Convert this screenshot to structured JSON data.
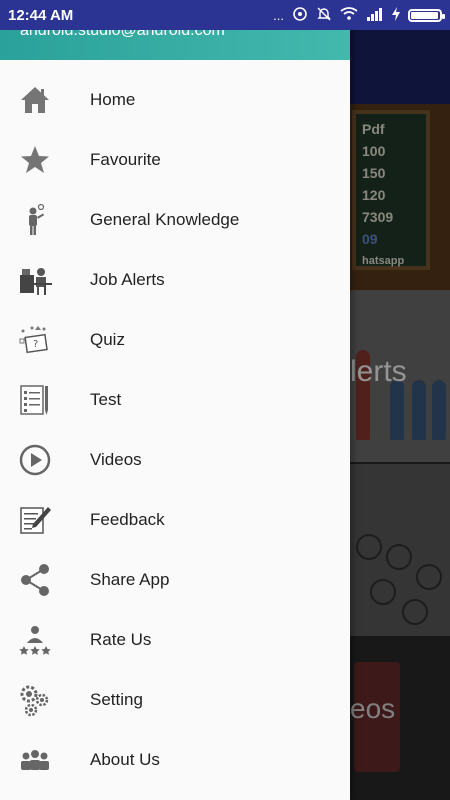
{
  "status_bar": {
    "time": "12:44 AM",
    "dots": "...",
    "icons": [
      "hotspot-icon",
      "mute-icon",
      "wifi-icon",
      "signal-icon",
      "charging-icon",
      "battery-icon"
    ],
    "battery_level": 0.95
  },
  "drawer": {
    "header_email": "android.studio@android.com",
    "header_color": "#2aa19a",
    "items": [
      {
        "label": "Home",
        "icon": "home-icon"
      },
      {
        "label": "Favourite",
        "icon": "star-icon"
      },
      {
        "label": "General Knowledge",
        "icon": "person-idea-icon"
      },
      {
        "label": "Job Alerts",
        "icon": "desk-worker-icon"
      },
      {
        "label": "Quiz",
        "icon": "quiz-icon"
      },
      {
        "label": "Test",
        "icon": "checklist-icon"
      },
      {
        "label": "Videos",
        "icon": "play-circle-icon"
      },
      {
        "label": "Feedback",
        "icon": "edit-note-icon"
      },
      {
        "label": "Share App",
        "icon": "share-icon"
      },
      {
        "label": "Rate Us",
        "icon": "rate-icon"
      },
      {
        "label": "Setting",
        "icon": "gears-icon"
      },
      {
        "label": "About Us",
        "icon": "group-icon"
      }
    ]
  },
  "background": {
    "card1_lines": [
      "Pdf",
      "100",
      "150",
      "120",
      "7309",
      "09",
      "hatsapp"
    ],
    "card2_text": "lerts",
    "card4_text": "eos"
  }
}
